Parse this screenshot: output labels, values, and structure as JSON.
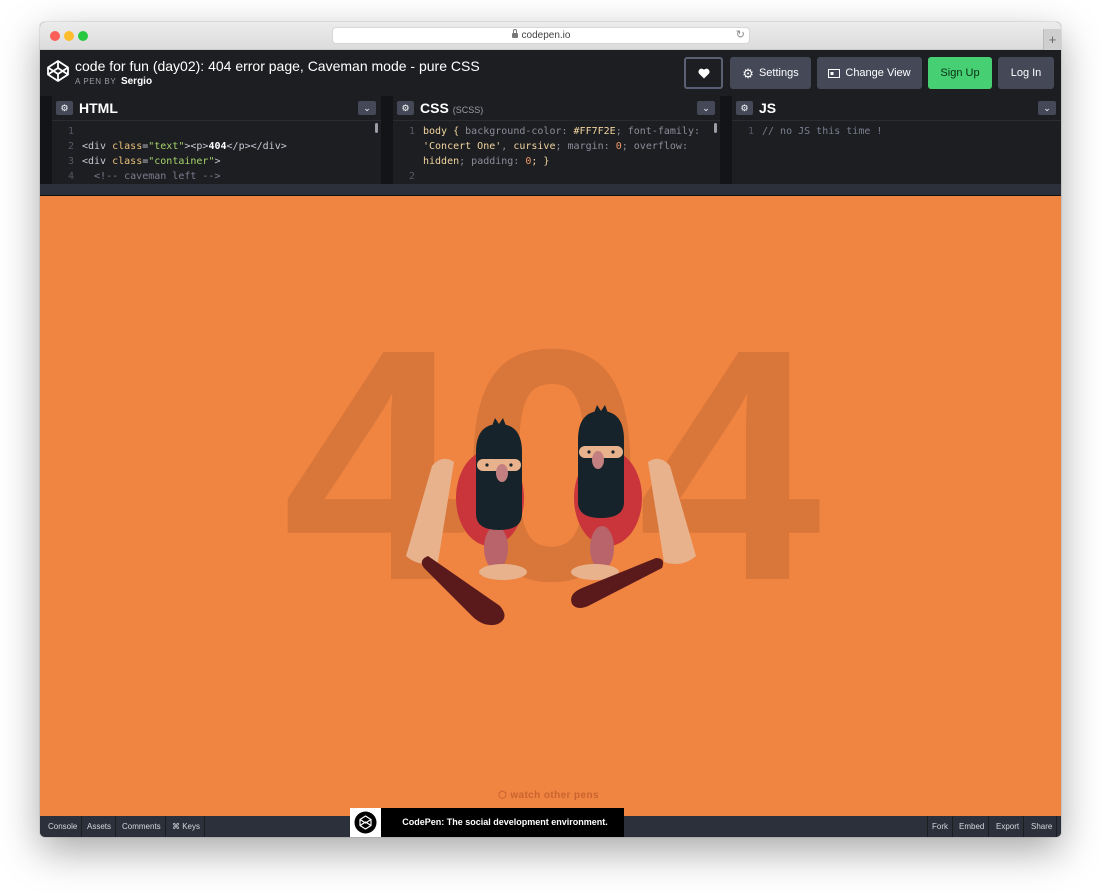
{
  "browser": {
    "url": "codepen.io"
  },
  "header": {
    "pen_title": "code for fun (day02): 404 error page, Caveman mode - pure CSS",
    "pen_by_label": "A PEN BY",
    "author": "Sergio",
    "buttons": {
      "settings": "Settings",
      "change_view": "Change View",
      "sign_up": "Sign Up",
      "log_in": "Log In"
    }
  },
  "editors": {
    "html": {
      "title": "HTML",
      "lines": [
        {
          "n": "1",
          "parts": []
        },
        {
          "n": "2",
          "parts": [
            {
              "t": "<div ",
              "c": "tag"
            },
            {
              "t": "class",
              "c": "attr"
            },
            {
              "t": "=",
              "c": "tag"
            },
            {
              "t": "\"text\"",
              "c": "str"
            },
            {
              "t": "><p>",
              "c": "tag"
            },
            {
              "t": "404",
              "c": "bold"
            },
            {
              "t": "</p></div>",
              "c": "tag"
            }
          ]
        },
        {
          "n": "3",
          "parts": [
            {
              "t": "<div ",
              "c": "tag"
            },
            {
              "t": "class",
              "c": "attr"
            },
            {
              "t": "=",
              "c": "tag"
            },
            {
              "t": "\"container\"",
              "c": "str"
            },
            {
              "t": ">",
              "c": "tag"
            }
          ]
        },
        {
          "n": "4",
          "parts": [
            {
              "t": "  <!-- caveman left -->",
              "c": "cmt"
            }
          ]
        }
      ]
    },
    "css": {
      "title": "CSS",
      "subtitle": "(SCSS)",
      "lines": [
        {
          "n": "1",
          "parts": [
            {
              "t": "body { ",
              "c": "sel"
            },
            {
              "t": "background-color: ",
              "c": "prop"
            },
            {
              "t": "#FF7F2E",
              "c": "val2"
            },
            {
              "t": "; ",
              "c": "prop"
            },
            {
              "t": "font-family:",
              "c": "prop"
            }
          ]
        },
        {
          "n": "",
          "parts": [
            {
              "t": "'Concert One'",
              "c": "val2"
            },
            {
              "t": ", ",
              "c": "prop"
            },
            {
              "t": "cursive",
              "c": "val2"
            },
            {
              "t": "; ",
              "c": "prop"
            },
            {
              "t": "margin: ",
              "c": "prop"
            },
            {
              "t": "0",
              "c": "val"
            },
            {
              "t": "; ",
              "c": "prop"
            },
            {
              "t": "overflow:",
              "c": "prop"
            }
          ]
        },
        {
          "n": "",
          "parts": [
            {
              "t": "hidden",
              "c": "val2"
            },
            {
              "t": "; ",
              "c": "prop"
            },
            {
              "t": "padding: ",
              "c": "prop"
            },
            {
              "t": "0",
              "c": "val"
            },
            {
              "t": "; }",
              "c": "sel"
            }
          ]
        },
        {
          "n": "2",
          "parts": []
        }
      ]
    },
    "js": {
      "title": "JS",
      "lines": [
        {
          "n": "1",
          "parts": [
            {
              "t": "// no JS this time !",
              "c": "cmt"
            }
          ]
        }
      ]
    }
  },
  "preview": {
    "big_text": "404",
    "watch_link": "watch other pens",
    "colors": {
      "background": "#f08542",
      "text_404": "#d9763a",
      "beard": "#16232a",
      "skin": "#e8b28d",
      "tunic": "#c9353b",
      "club": "#5a1a1c"
    }
  },
  "footer": {
    "left": [
      "Console",
      "Assets",
      "Comments",
      "⌘ Keys"
    ],
    "right": [
      "Fork",
      "Embed",
      "Export",
      "Share"
    ],
    "promo": "CodePen: The social development environment."
  }
}
